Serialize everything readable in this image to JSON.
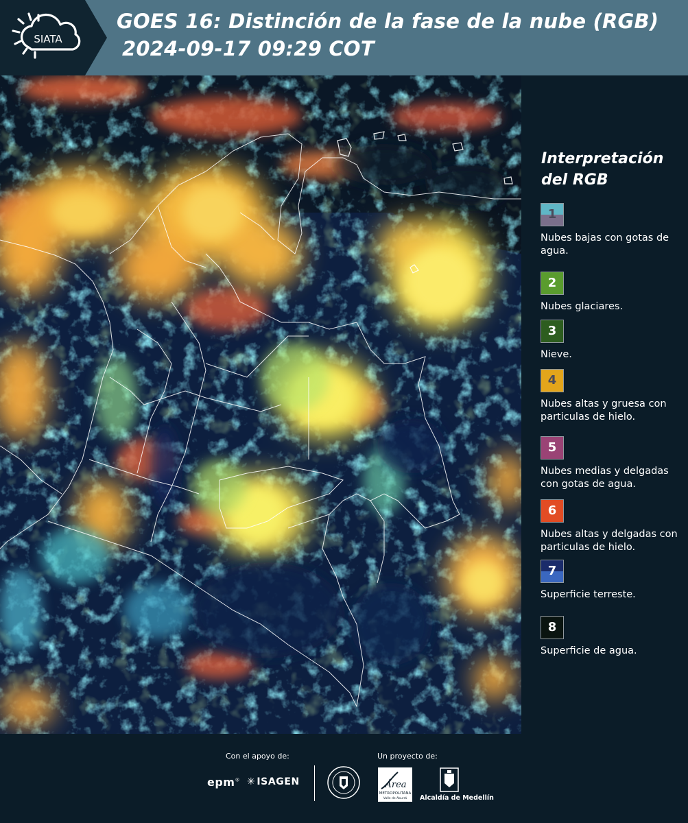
{
  "header": {
    "logo_text": "SIATA",
    "title": "GOES 16: Distinción de la fase de la nube (RGB)",
    "timestamp": "2024-09-17 09:29 COT",
    "background_color": "#4f7486"
  },
  "map": {
    "description_icon": "satellite-rgb-imagery",
    "ocean_color": "#0c1d3a",
    "cloud_colors": [
      "#f3b33d",
      "#f6e04a",
      "#9edb6a",
      "#3fb8c2",
      "#e06a3c"
    ]
  },
  "legend": {
    "title_line1": "Interpretación",
    "title_line2": "del RGB",
    "items": [
      {
        "number": "1",
        "label": "Nubes bajas con gotas de agua.",
        "color_top": "#5fb6c6",
        "color_bottom": "#7b6f8b",
        "number_color": "#4a4a5a"
      },
      {
        "number": "2",
        "label": "Nubes glaciares.",
        "color_top": "#5a9c2e",
        "color_bottom": "#5a9c2e",
        "number_color": "#ffffff"
      },
      {
        "number": "3",
        "label": "Nieve.",
        "color_top": "#2d5d1f",
        "color_bottom": "#2d5d1f",
        "number_color": "#ffffff"
      },
      {
        "number": "4",
        "label": "Nubes altas y gruesa con particulas de hielo.",
        "color_top": "#e3a51b",
        "color_bottom": "#e3a51b",
        "number_color": "#4a4a5a"
      },
      {
        "number": "5",
        "label": "Nubes medias y delgadas con gotas de agua.",
        "color_top": "#9a4375",
        "color_bottom": "#9a4375",
        "number_color": "#ffffff"
      },
      {
        "number": "6",
        "label": "Nubes altas y delgadas con particulas de hielo.",
        "color_top": "#e24c24",
        "color_bottom": "#e24c24",
        "number_color": "#ffffff"
      },
      {
        "number": "7",
        "label": "Superficie terreste.",
        "color_top": "#1a2b6a",
        "color_bottom": "#3a67c0",
        "number_color": "#ffffff"
      },
      {
        "number": "8",
        "label": "Superficie de agua.",
        "color_top": "#0a1410",
        "color_bottom": "#0a1410",
        "number_color": "#ffffff"
      }
    ]
  },
  "footer": {
    "support_label": "Con el apoyo de:",
    "project_label": "Un proyecto de:",
    "sponsor_epm": "epm",
    "sponsor_isagen": "ISAGEN",
    "amva_name": "Área",
    "amva_subtitle": "METROPOLITANA",
    "amva_sub2": "Valle de Aburrá",
    "alcaldia_name": "Alcaldía de Medellín"
  }
}
